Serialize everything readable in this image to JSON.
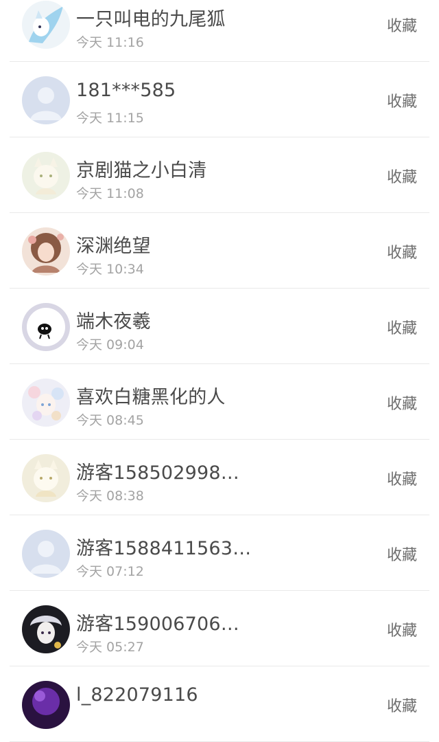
{
  "list": {
    "items": [
      {
        "name": "一只叫电的九尾狐",
        "time": "今天 11:16",
        "action": "收藏",
        "avatar": "fox-avatar"
      },
      {
        "name": "181***585",
        "time": "今天 11:15",
        "action": "收藏",
        "avatar": "default-avatar"
      },
      {
        "name": "京剧猫之小白清",
        "time": "今天 11:08",
        "action": "收藏",
        "avatar": "cat-avatar"
      },
      {
        "name": "深渊绝望",
        "time": "今天 10:34",
        "action": "收藏",
        "avatar": "girl-avatar"
      },
      {
        "name": "端木夜羲",
        "time": "今天 09:04",
        "action": "收藏",
        "avatar": "black-cat-avatar"
      },
      {
        "name": "喜欢白糖黑化的人",
        "time": "今天 08:45",
        "action": "收藏",
        "avatar": "pastel-avatar"
      },
      {
        "name": "游客158502998…",
        "time": "今天 08:38",
        "action": "收藏",
        "avatar": "cat-avatar"
      },
      {
        "name": "游客1588411563…",
        "time": "今天 07:12",
        "action": "收藏",
        "avatar": "default-avatar"
      },
      {
        "name": "游客159006706…",
        "time": "今天 05:27",
        "action": "收藏",
        "avatar": "dark-boy-avatar"
      },
      {
        "name": "l_822079116",
        "time": "",
        "action": "收藏",
        "avatar": "purple-avatar"
      }
    ]
  }
}
